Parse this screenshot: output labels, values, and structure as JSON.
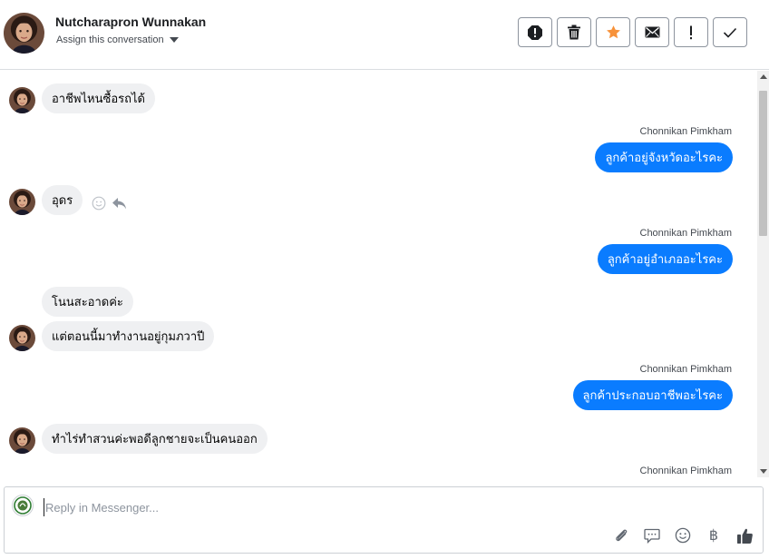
{
  "header": {
    "contact_name": "Nutcharapron Wunnakan",
    "assign_label": "Assign this conversation",
    "toolbar": [
      {
        "icon": "alert-circle-icon",
        "name": "mark-spam-button"
      },
      {
        "icon": "trash-icon",
        "name": "delete-button"
      },
      {
        "icon": "star-icon",
        "name": "star-button"
      },
      {
        "icon": "envelope-icon",
        "name": "mark-unread-button"
      },
      {
        "icon": "exclamation-icon",
        "name": "follow-up-button"
      },
      {
        "icon": "checkmark-icon",
        "name": "mark-done-button"
      }
    ]
  },
  "messages": {
    "m1": "อาชีพไหนซื้อรถได้",
    "s2": "Chonnikan Pimkham",
    "m2": "ลูกค้าอยู่จังหวัดอะไรคะ",
    "m3": "อุดร",
    "s4": "Chonnikan Pimkham",
    "m4": "ลูกค้าอยู่อำเภออะไรคะ",
    "m5": "โนนสะอาดค่ะ",
    "m6": "แต่ตอนนี้มาทำงานอยู่กุมภวาปี",
    "s7": "Chonnikan Pimkham",
    "m7": "ลูกค้าประกอบอาชีพอะไรคะ",
    "m8": "ทำไร่ทำสวนค่ะพอดีลูกชายจะเป็นคนออก",
    "s9": "Chonnikan Pimkham"
  },
  "composer": {
    "placeholder": "Reply in Messenger...",
    "tools": [
      "paperclip-icon",
      "chat-bubble-icon",
      "smiley-icon",
      "baht-icon",
      "thumbs-up-icon"
    ],
    "baht_symbol": "฿"
  },
  "colors": {
    "outgoing_bubble": "#0a7cff",
    "incoming_bubble": "#eff0f2",
    "star": "#f7923a"
  }
}
